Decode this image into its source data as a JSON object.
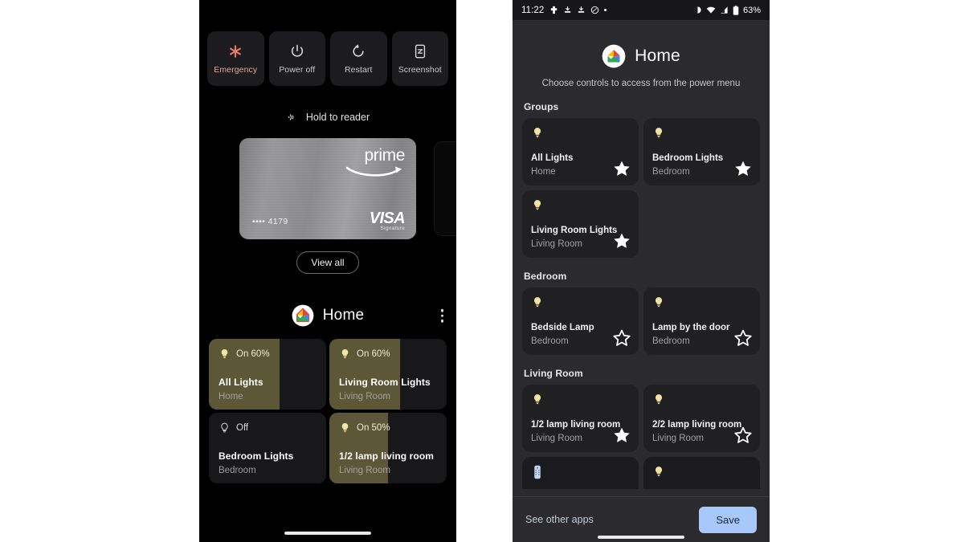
{
  "left_phone": {
    "power_actions": [
      {
        "icon": "emergency-icon",
        "label": "Emergency"
      },
      {
        "icon": "power-off-icon",
        "label": "Power off"
      },
      {
        "icon": "restart-icon",
        "label": "Restart"
      },
      {
        "icon": "screenshot-icon",
        "label": "Screenshot"
      }
    ],
    "hold_to_reader": {
      "icon": "nfc-icon",
      "label": "Hold to reader"
    },
    "wallet_card": {
      "brand": "prime",
      "network": "VISA",
      "network_sub": "Signature",
      "number": "•••• 4179"
    },
    "view_all_label": "View all",
    "home": {
      "logo": "google-home-icon",
      "title": "Home",
      "menu_icon": "kebab-menu-icon"
    },
    "controls": [
      {
        "state": "On 60%",
        "fill_pct": 60,
        "on": true,
        "name": "All Lights",
        "room": "Home"
      },
      {
        "state": "On 60%",
        "fill_pct": 60,
        "on": true,
        "name": "Living Room Lights",
        "room": "Living Room"
      },
      {
        "state": "Off",
        "fill_pct": 0,
        "on": false,
        "name": "Bedroom Lights",
        "room": "Bedroom"
      },
      {
        "state": "On 50%",
        "fill_pct": 50,
        "on": true,
        "name": "1/2 lamp living room",
        "room": "Living Room"
      }
    ]
  },
  "right_phone": {
    "statusbar": {
      "time": "11:22",
      "left_icons": [
        "accessibility-icon",
        "download-icon",
        "download-icon",
        "do-not-disturb-icon",
        "dot-icon"
      ],
      "right_icons": [
        "vibrate-icon",
        "wifi-icon",
        "signal-icon",
        "battery-icon"
      ],
      "battery": "63%"
    },
    "header": {
      "logo": "google-home-icon",
      "title": "Home",
      "subtitle": "Choose controls to access from the power menu"
    },
    "sections": [
      {
        "label": "Groups",
        "items": [
          {
            "icon": "bulb-icon",
            "name": "All Lights",
            "room": "Home",
            "starred": true
          },
          {
            "icon": "bulb-icon",
            "name": "Bedroom Lights",
            "room": "Bedroom",
            "starred": true
          },
          {
            "icon": "bulb-icon",
            "name": "Living Room Lights",
            "room": "Living Room",
            "starred": true
          }
        ]
      },
      {
        "label": "Bedroom",
        "items": [
          {
            "icon": "bulb-icon",
            "name": "Bedside Lamp",
            "room": "Bedroom",
            "starred": false
          },
          {
            "icon": "bulb-icon",
            "name": "Lamp by the door",
            "room": "Bedroom",
            "starred": false
          }
        ]
      },
      {
        "label": "Living Room",
        "items": [
          {
            "icon": "bulb-icon",
            "name": "1/2 lamp living room",
            "room": "Living Room",
            "starred": true
          },
          {
            "icon": "bulb-icon",
            "name": "2/2 lamp living room",
            "room": "Living Room",
            "starred": false
          },
          {
            "icon": "remote-icon",
            "name": "",
            "room": "",
            "starred": false
          },
          {
            "icon": "bulb-icon",
            "name": "",
            "room": "",
            "starred": false
          }
        ]
      }
    ],
    "footer": {
      "see_other_apps": "See other apps",
      "save_label": "Save"
    }
  },
  "colors": {
    "tile_fill": "#5c5737",
    "save_blue": "#a8c7fa",
    "emergency_red": "#e8a398",
    "page_bg": "#ffffff"
  }
}
